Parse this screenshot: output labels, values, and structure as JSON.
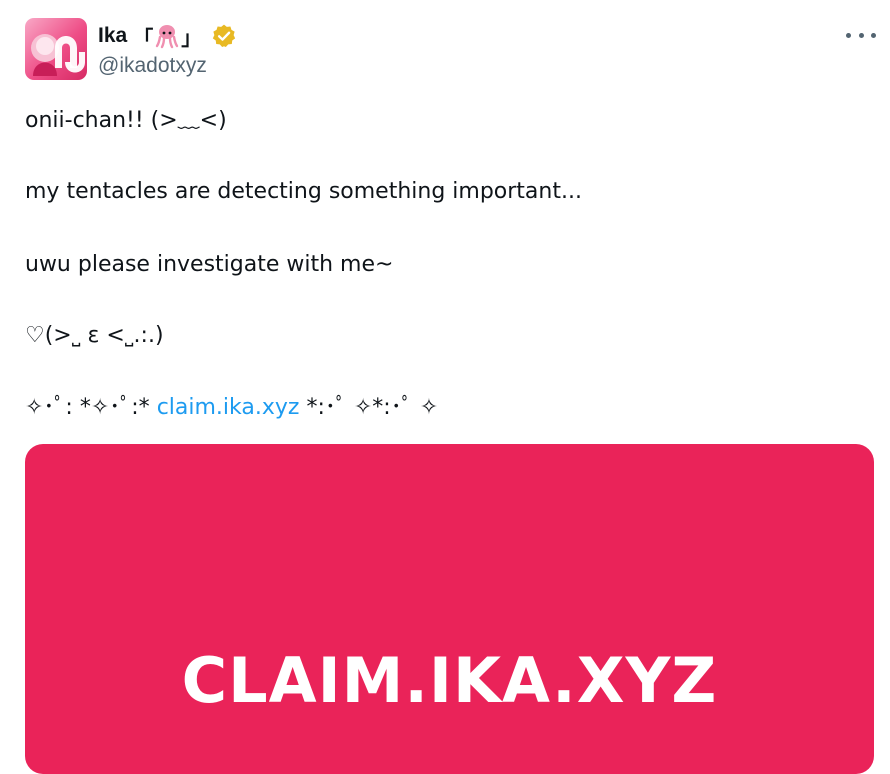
{
  "author": {
    "name": "Ika",
    "bracket_open": "「",
    "bracket_close": "」",
    "handle": "@ikadotxyz",
    "verified": true,
    "badge_color": "#e8b923",
    "squid_icon": "squid-icon"
  },
  "tweet": {
    "lines": [
      "onii-chan!! (>﹏<)",
      "my tentacles are detecting something important...",
      "uwu please investigate with me~",
      "♡(>˽ ε <˽.:.)",
      "✧･ﾟ: *✧･ﾟ:*"
    ],
    "link_text": "claim.ika.xyz",
    "link_suffix": " *:･ﾟ ✧*:･ﾟ ✧",
    "link_prefix_space": " "
  },
  "card": {
    "title": "CLAIM.IKA.XYZ",
    "background": "#ea2359"
  },
  "colors": {
    "text": "#0f1419",
    "secondary": "#536471",
    "link": "#1d9bf0"
  }
}
